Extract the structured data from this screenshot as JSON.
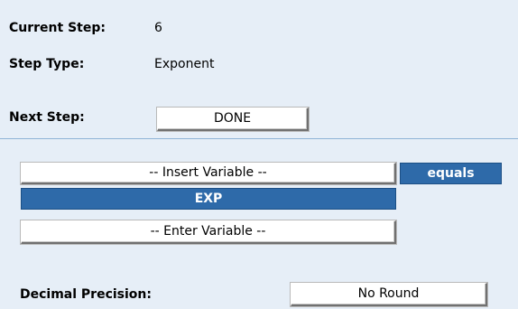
{
  "header": {
    "current_step_label": "Current Step:",
    "current_step_value": "6",
    "step_type_label": "Step Type:",
    "step_type_value": "Exponent",
    "next_step_label": "Next Step:",
    "next_step_button": "DONE"
  },
  "editor": {
    "insert_variable_button": "-- Insert Variable --",
    "equals_label": "equals",
    "exp_label": "EXP",
    "enter_variable_button": "-- Enter Variable --",
    "decimal_precision_label": "Decimal Precision:",
    "decimal_precision_button": "No Round"
  },
  "colors": {
    "background": "#e6eef7",
    "accent_blue": "#2e6aa9",
    "divider": "#8fb4d6"
  }
}
